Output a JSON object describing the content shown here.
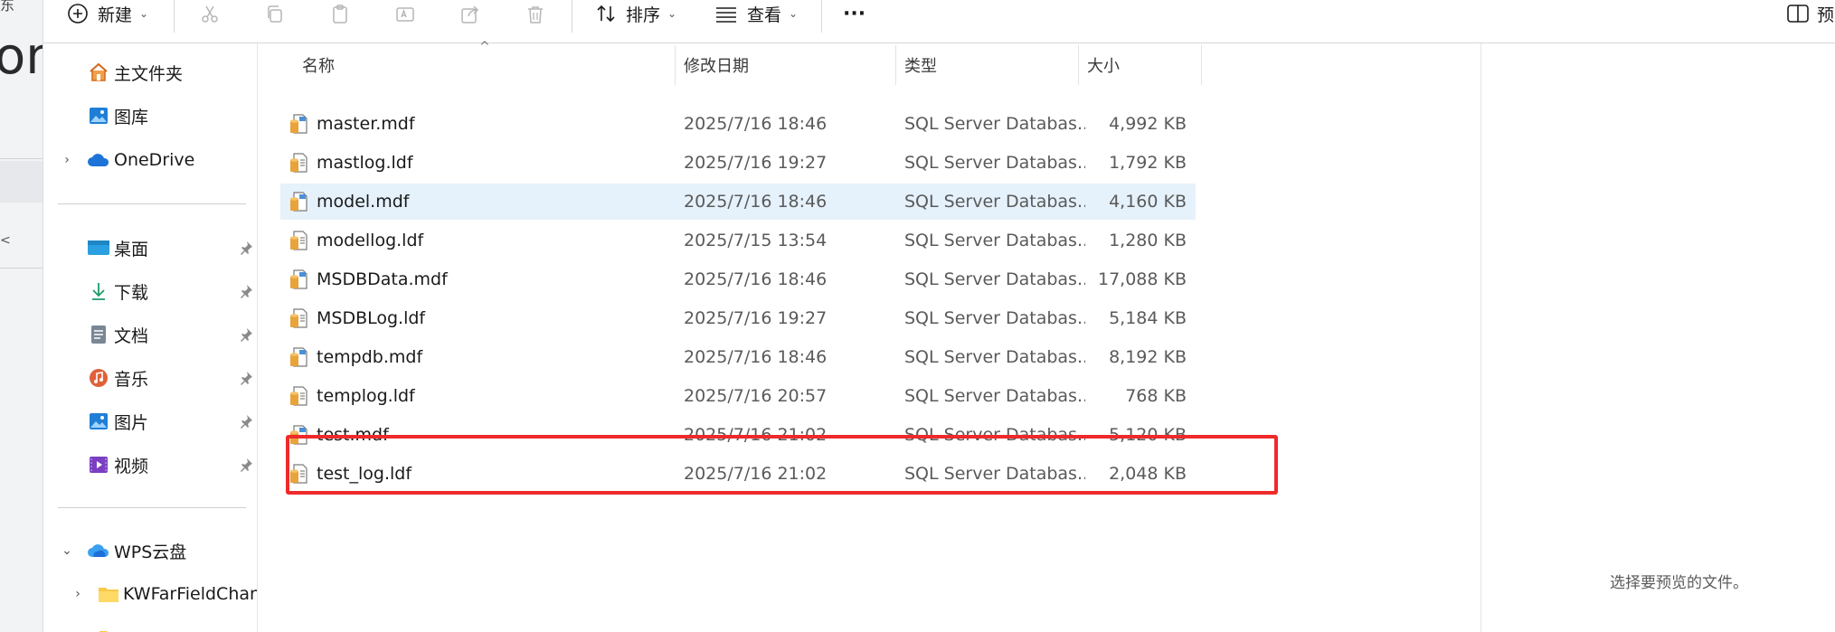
{
  "background_window": {
    "large_text": "on",
    "small_text": "东",
    "side_mark": "<"
  },
  "toolbar": {
    "new_label": "新建",
    "sort_label": "排序",
    "view_label": "查看",
    "more_label": "···",
    "preview_label": "预"
  },
  "nav": {
    "home": "主文件夹",
    "gallery": "图库",
    "onedrive": "OneDrive",
    "desktop": "桌面",
    "downloads": "下载",
    "documents": "文档",
    "music": "音乐",
    "pictures": "图片",
    "videos": "视频",
    "wps": "WPS云盘",
    "wps_child": "KWFarFieldChan"
  },
  "columns": {
    "name": "名称",
    "date": "修改日期",
    "type": "类型",
    "size": "大小"
  },
  "files": [
    {
      "name": "master.mdf",
      "date": "2025/7/16 18:46",
      "type": "SQL Server Databas...",
      "size": "4,992 KB",
      "kind": "mdf"
    },
    {
      "name": "mastlog.ldf",
      "date": "2025/7/16 19:27",
      "type": "SQL Server Databas...",
      "size": "1,792 KB",
      "kind": "ldf"
    },
    {
      "name": "model.mdf",
      "date": "2025/7/16 18:46",
      "type": "SQL Server Databas...",
      "size": "4,160 KB",
      "kind": "mdf"
    },
    {
      "name": "modellog.ldf",
      "date": "2025/7/15 13:54",
      "type": "SQL Server Databas...",
      "size": "1,280 KB",
      "kind": "ldf"
    },
    {
      "name": "MSDBData.mdf",
      "date": "2025/7/16 18:46",
      "type": "SQL Server Databas...",
      "size": "17,088 KB",
      "kind": "mdf"
    },
    {
      "name": "MSDBLog.ldf",
      "date": "2025/7/16 19:27",
      "type": "SQL Server Databas...",
      "size": "5,184 KB",
      "kind": "ldf"
    },
    {
      "name": "tempdb.mdf",
      "date": "2025/7/16 18:46",
      "type": "SQL Server Databas...",
      "size": "8,192 KB",
      "kind": "mdf"
    },
    {
      "name": "templog.ldf",
      "date": "2025/7/16 20:57",
      "type": "SQL Server Databas...",
      "size": "768 KB",
      "kind": "ldf"
    },
    {
      "name": "test.mdf",
      "date": "2025/7/16 21:02",
      "type": "SQL Server Databas...",
      "size": "5,120 KB",
      "kind": "mdf"
    },
    {
      "name": "test_log.ldf",
      "date": "2025/7/16 21:02",
      "type": "SQL Server Databas...",
      "size": "2,048 KB",
      "kind": "ldf"
    }
  ],
  "selected_row": 2,
  "highlighted_row": 9,
  "preview": {
    "message": "选择要预览的文件。"
  },
  "colors": {
    "selection": "#e5f1fb",
    "highlight_border": "#ee2a2a",
    "accent": "#0a64c8"
  }
}
